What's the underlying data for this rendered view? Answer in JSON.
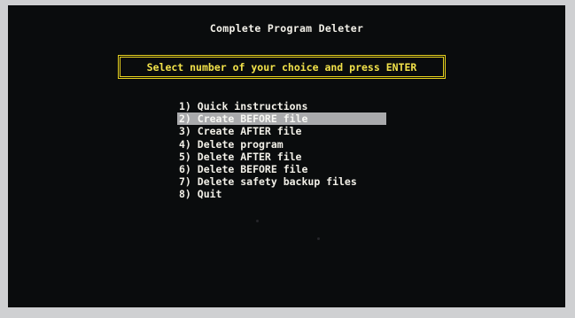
{
  "app": {
    "title": "Complete Program Deleter"
  },
  "prompt": {
    "text": "Select number of your choice and press ENTER"
  },
  "menu": {
    "selected_index": 1,
    "items": [
      {
        "label": "1) Quick instructions"
      },
      {
        "label": "2) Create BEFORE file"
      },
      {
        "label": "3) Create AFTER file"
      },
      {
        "label": "4) Delete program"
      },
      {
        "label": "5) Delete AFTER file"
      },
      {
        "label": "6) Delete BEFORE file"
      },
      {
        "label": "7) Delete safety backup files"
      },
      {
        "label": "8) Quit"
      }
    ]
  },
  "colors": {
    "screen_background": "#0a0c0d",
    "text": "#f2f0e8",
    "prompt_text": "#f2e24a",
    "prompt_border": "#e8d21e",
    "selection_highlight": "#a9aaac"
  }
}
